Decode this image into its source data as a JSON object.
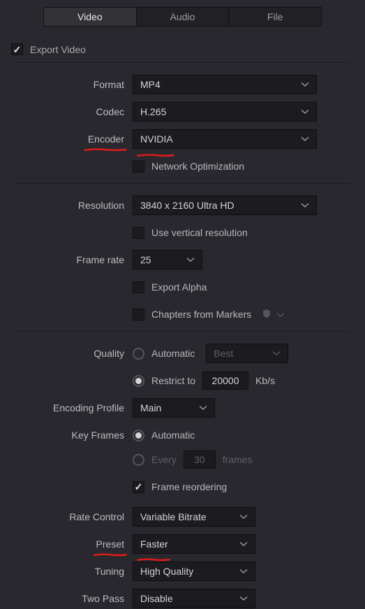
{
  "tabs": {
    "video": "Video",
    "audio": "Audio",
    "file": "File"
  },
  "export_video": "Export Video",
  "format": {
    "label": "Format",
    "value": "MP4"
  },
  "codec": {
    "label": "Codec",
    "value": "H.265"
  },
  "encoder": {
    "label": "Encoder",
    "value": "NVIDIA"
  },
  "network_opt": "Network Optimization",
  "resolution": {
    "label": "Resolution",
    "value": "3840 x 2160 Ultra HD"
  },
  "use_vertical": "Use vertical resolution",
  "frame_rate": {
    "label": "Frame rate",
    "value": "25"
  },
  "export_alpha": "Export Alpha",
  "chapters_markers": "Chapters from Markers",
  "quality": {
    "label": "Quality",
    "automatic": "Automatic",
    "best": "Best",
    "restrict": "Restrict to",
    "value": "20000",
    "unit": "Kb/s"
  },
  "encoding_profile": {
    "label": "Encoding Profile",
    "value": "Main"
  },
  "key_frames": {
    "label": "Key Frames",
    "automatic": "Automatic",
    "every": "Every",
    "value": "30",
    "unit": "frames"
  },
  "frame_reorder": "Frame reordering",
  "rate_control": {
    "label": "Rate Control",
    "value": "Variable Bitrate"
  },
  "preset": {
    "label": "Preset",
    "value": "Faster"
  },
  "tuning": {
    "label": "Tuning",
    "value": "High Quality"
  },
  "two_pass": {
    "label": "Two Pass",
    "value": "Disable"
  }
}
